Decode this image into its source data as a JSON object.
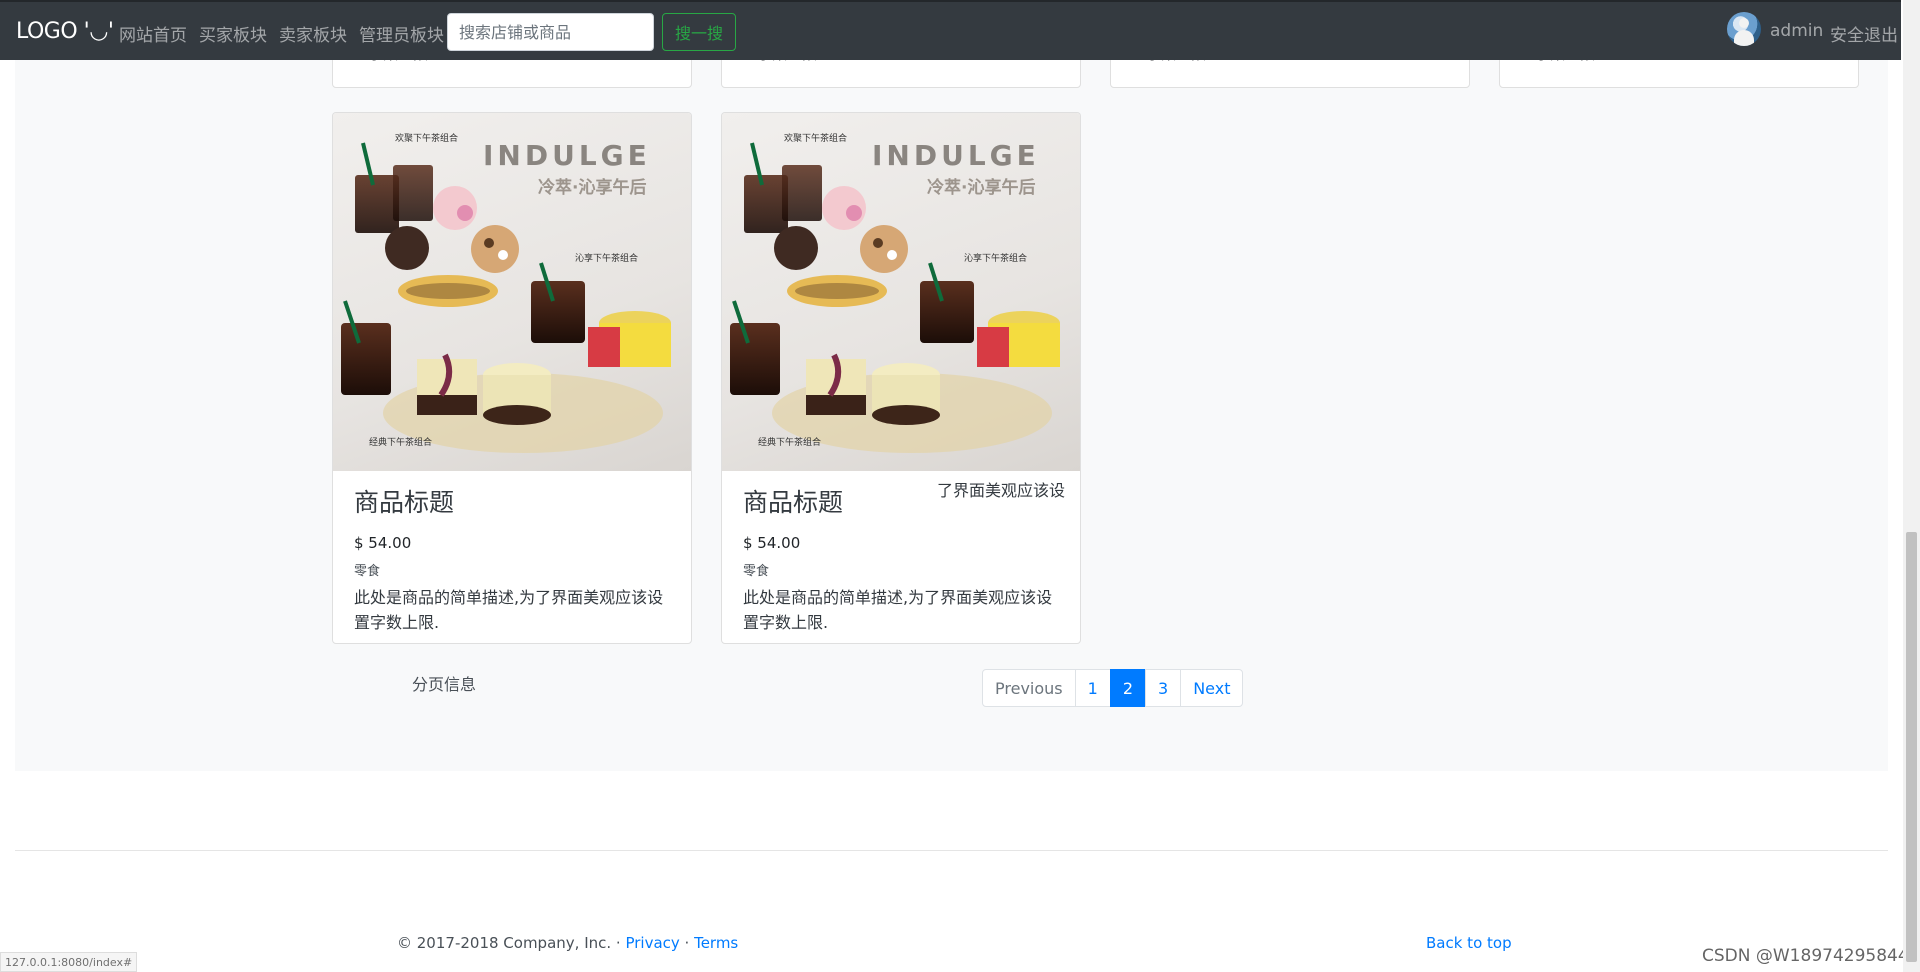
{
  "navbar": {
    "brand": "LOGO '◡'",
    "links": [
      "网站首页",
      "买家板块",
      "卖家板块",
      "管理员板块"
    ],
    "search_placeholder": "搜索店铺或商品",
    "search_button": "搜一搜",
    "user_name": "admin",
    "logout": "安全退出"
  },
  "top_cards_partial": [
    "置字数上限.",
    "置字数上限.",
    "置字数上限.",
    "置字数上限."
  ],
  "products": [
    {
      "title": "商品标题",
      "price": "$ 54.00",
      "category": "零食",
      "description": "此处是商品的简单描述,为了界面美观应该设置字数上限.",
      "image": "afternoon-tea-set-image"
    },
    {
      "title": "商品标题",
      "price": "$ 54.00",
      "category": "零食",
      "description": "此处是商品的简单描述,为了界面美观应该设置字数上限.",
      "image": "afternoon-tea-set-image"
    }
  ],
  "tooltip_fragment": "了界面美观应该设",
  "pagination": {
    "info": "分页信息",
    "previous": "Previous",
    "pages": [
      "1",
      "2",
      "3"
    ],
    "current": "2",
    "next": "Next"
  },
  "footer": {
    "copyright": "© 2017-2018 Company, Inc. · ",
    "privacy": "Privacy",
    "separator": " · ",
    "terms": "Terms",
    "back_to_top": "Back to top"
  },
  "status_url": "127.0.0.1:8080/index#",
  "watermark": "CSDN @W18974295844",
  "colors": {
    "navbar_bg": "#343a40",
    "primary": "#007bff",
    "success": "#28a745",
    "album_bg": "#f8f9fa"
  }
}
